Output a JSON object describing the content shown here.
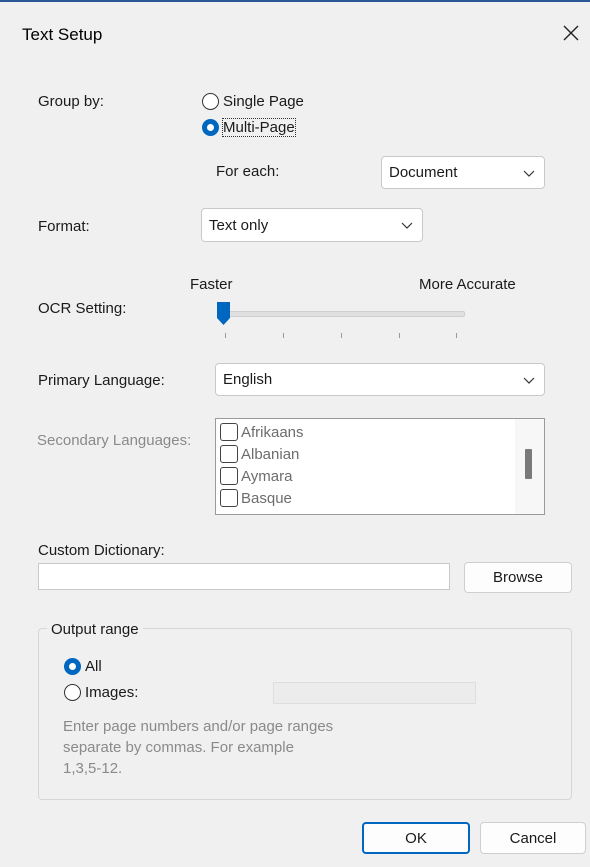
{
  "dialog": {
    "title": "Text Setup"
  },
  "group_by": {
    "label": "Group by:",
    "options": [
      {
        "label": "Single Page",
        "selected": false
      },
      {
        "label": "Multi-Page",
        "selected": true
      }
    ],
    "for_each_label": "For each:",
    "for_each_value": "Document"
  },
  "format": {
    "label": "Format:",
    "value": "Text only"
  },
  "ocr": {
    "label": "OCR Setting:",
    "min_label": "Faster",
    "max_label": "More Accurate",
    "level": 0,
    "ticks": 5
  },
  "primary_language": {
    "label": "Primary Language:",
    "value": "English"
  },
  "secondary_languages": {
    "label": "Secondary Languages:",
    "items": [
      {
        "label": "Afrikaans",
        "checked": false
      },
      {
        "label": "Albanian",
        "checked": false
      },
      {
        "label": "Aymara",
        "checked": false
      },
      {
        "label": "Basque",
        "checked": false
      }
    ]
  },
  "custom_dictionary": {
    "label": "Custom Dictionary:",
    "value": "",
    "browse_label": "Browse"
  },
  "output_range": {
    "legend": "Output range",
    "all_label": "All",
    "all_selected": true,
    "images_label": "Images:",
    "images_selected": false,
    "images_value": "",
    "hint": "Enter page numbers and/or page ranges\nseparate by commas.  For example\n1,3,5-12."
  },
  "buttons": {
    "ok": "OK",
    "cancel": "Cancel"
  },
  "colors": {
    "accent": "#0067c0",
    "background": "#f0f0f0",
    "disabled_text": "#8a8a8a"
  }
}
